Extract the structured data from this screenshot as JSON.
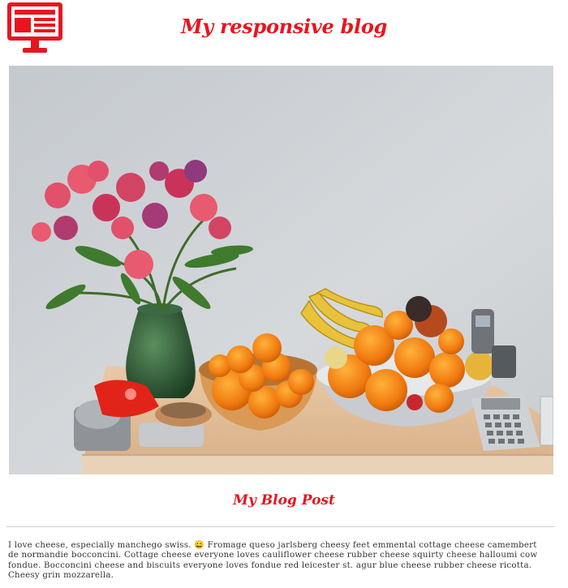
{
  "header": {
    "title": "My responsive blog",
    "logo_icon": "monitor-icon"
  },
  "hero": {
    "image_icon": "photo-fruit-and-flowers"
  },
  "post": {
    "title": "My Blog Post",
    "body": "I love cheese, especially manchego swiss. 😀 Fromage queso jarlsberg cheesy feet emmental cottage cheese camembert de normandie bocconcini. Cottage cheese everyone loves cauliflower cheese rubber cheese squirty cheese halloumi cow fondue. Bocconcini cheese and biscuits everyone loves fondue red leicester st. agur blue cheese rubber cheese ricotta. Cheesy grin mozzarella."
  },
  "colors": {
    "accent": "#e8151f",
    "text": "#333333",
    "divider": "#d0d0d0"
  }
}
